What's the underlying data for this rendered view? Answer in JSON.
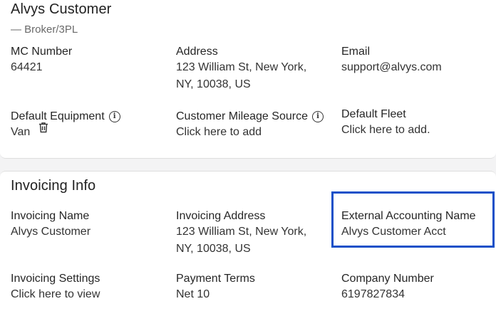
{
  "customer": {
    "name": "Alvys Customer",
    "type": "— Broker/3PL"
  },
  "details": {
    "mc_number": {
      "label": "MC Number",
      "value": "64421"
    },
    "address": {
      "label": "Address",
      "line1": "123 William St, New York,",
      "line2": "NY, 10038, US"
    },
    "email": {
      "label": "Email",
      "value": "support@alvys.com"
    },
    "default_equipment": {
      "label": "Default Equipment",
      "value": "Van",
      "info_icon": "info-icon",
      "delete_icon": "trash-icon"
    },
    "mileage_source": {
      "label": "Customer Mileage Source",
      "value": "Click here to add",
      "info_icon": "info-icon"
    },
    "default_fleet": {
      "label": "Default Fleet",
      "value": "Click here to add."
    }
  },
  "invoicing": {
    "heading": "Invoicing Info",
    "name": {
      "label": "Invoicing Name",
      "value": "Alvys Customer"
    },
    "address": {
      "label": "Invoicing Address",
      "line1": "123 William St, New York,",
      "line2": "NY, 10038, US"
    },
    "external_accounting_name": {
      "label": "External Accounting Name",
      "value": "Alvys Customer Acct"
    },
    "settings": {
      "label": "Invoicing Settings",
      "value": "Click here to view"
    },
    "payment_terms": {
      "label": "Payment Terms",
      "value": "Net 10"
    },
    "company_number": {
      "label": "Company Number",
      "value": "6197827834"
    }
  },
  "colors": {
    "highlight_border": "#1450c8",
    "background": "#f3f3f4",
    "card": "#ffffff"
  }
}
